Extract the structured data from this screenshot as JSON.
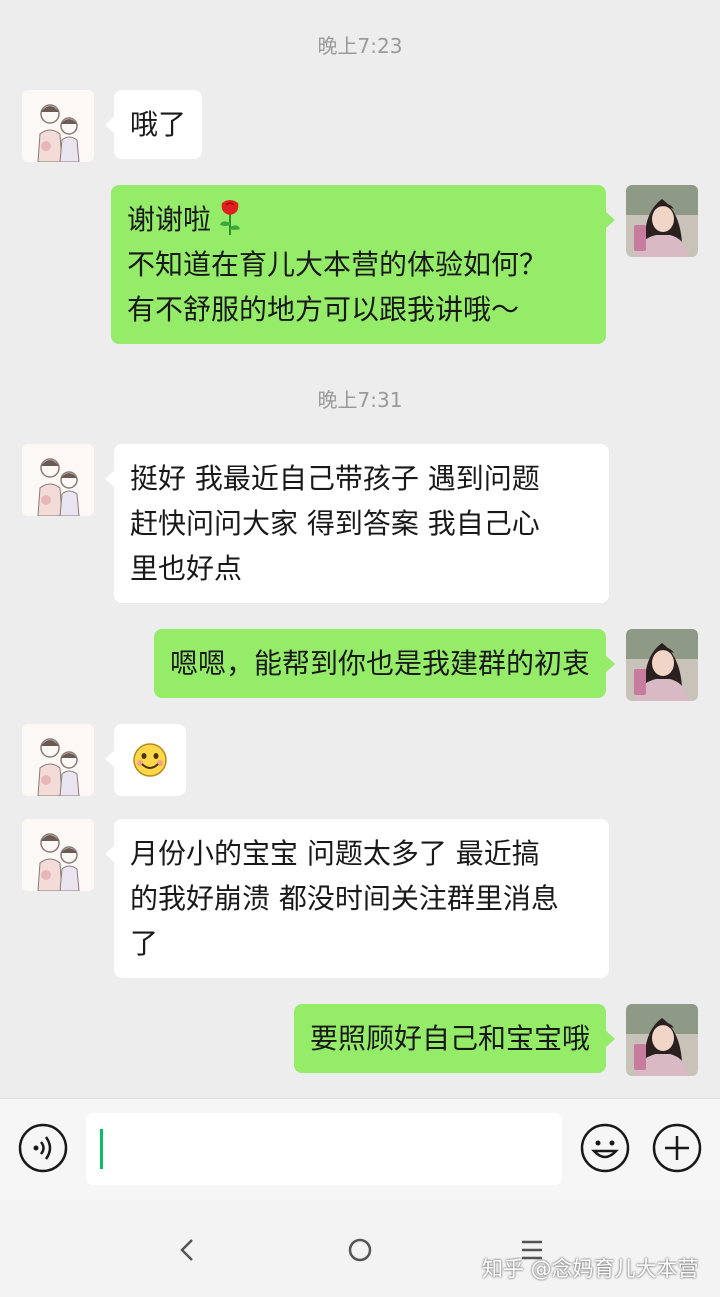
{
  "chat": {
    "timestamps": [
      "晚上7:23",
      "晚上7:31"
    ],
    "messages": [
      {
        "from": "other",
        "lines": [
          "哦了"
        ]
      },
      {
        "from": "me",
        "lines": [
          "谢谢啦",
          "不知道在育儿大本营的体验如何？",
          "有不舒服的地方可以跟我讲哦～"
        ],
        "emoji": "rose-icon"
      },
      {
        "from": "other",
        "lines": [
          "挺好 我最近自己带孩子 遇到问题",
          "赶快问问大家 得到答案 我自己心",
          "里也好点"
        ]
      },
      {
        "from": "me",
        "lines": [
          "嗯嗯，能帮到你也是我建群的初衷"
        ]
      },
      {
        "from": "other",
        "emoji": "smiley-icon"
      },
      {
        "from": "other",
        "lines": [
          "月份小的宝宝 问题太多了 最近搞",
          "的我好崩溃 都没时间关注群里消息",
          "了"
        ]
      },
      {
        "from": "me",
        "lines": [
          "要照顾好自己和宝宝哦"
        ]
      }
    ]
  },
  "input_bar": {
    "value": "",
    "icons": [
      "voice-icon",
      "emoji-icon",
      "plus-icon"
    ]
  },
  "navigation": {
    "icons": [
      "back-icon",
      "home-icon",
      "menu-icon"
    ]
  },
  "watermark": "知乎 @念妈育儿大本营",
  "colors": {
    "background": "#ededed",
    "outgoing_bubble": "#95ec69",
    "incoming_bubble": "#ffffff",
    "caret": "#07c160"
  }
}
